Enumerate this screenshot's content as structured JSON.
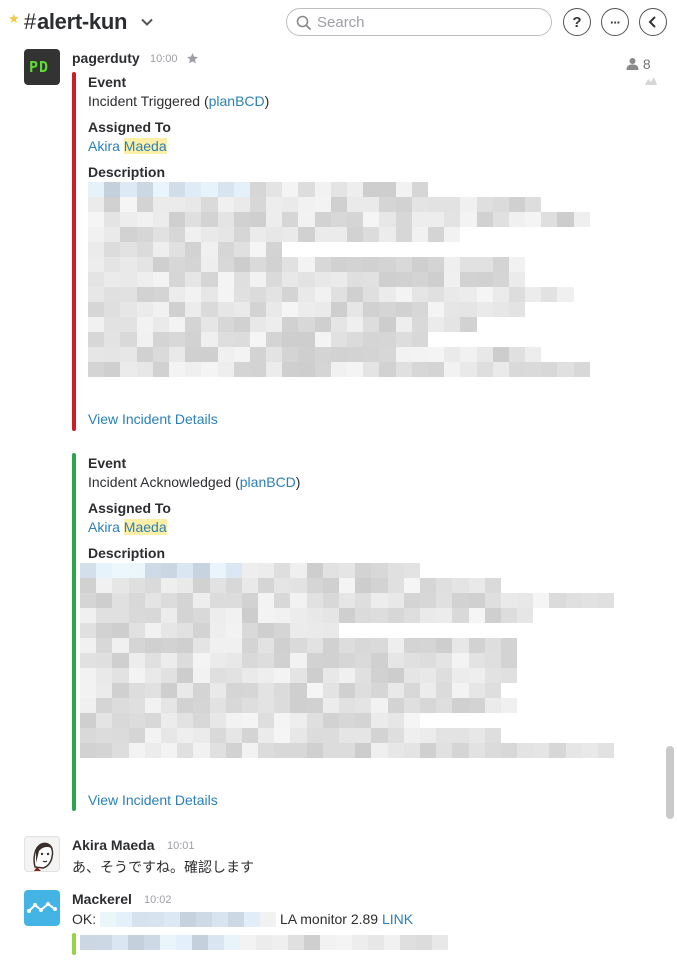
{
  "header": {
    "channel_name": "alert-kun",
    "search_placeholder": "Search",
    "help_label": "?",
    "more_label": "···",
    "back_label": "‹"
  },
  "member_count": "8",
  "messages": [
    {
      "sender": "pagerduty",
      "time": "10:00",
      "avatar_text": "PD",
      "attachments": [
        {
          "accent": "#cc1f24",
          "event_label": "Event",
          "event_text": "Incident Triggered (",
          "event_link": "planBCD",
          "event_close": ")",
          "assigned_label": "Assigned To",
          "assignee_first": "Akira",
          "assignee_last": "Maeda",
          "description_label": "Description",
          "details_link": "View Incident Details"
        },
        {
          "accent": "#2fa44f",
          "event_label": "Event",
          "event_text": "Incident Acknowledged (",
          "event_link": "planBCD",
          "event_close": ")",
          "assigned_label": "Assigned To",
          "assignee_first": "Akira",
          "assignee_last": "Maeda",
          "description_label": "Description",
          "details_link": "View Incident Details"
        }
      ]
    },
    {
      "sender": "Akira Maeda",
      "time": "10:01",
      "text": "あ、そうですね。確認します"
    },
    {
      "sender": "Mackerel",
      "time": "10:02",
      "text_prefix": "OK:",
      "text_suffix": "LA monitor 2.89",
      "link": "LINK",
      "accent": "#9bd14a"
    }
  ],
  "colors": {
    "link": "#2a80b9",
    "highlight": "#fcefa7",
    "star": "#f2c744"
  }
}
